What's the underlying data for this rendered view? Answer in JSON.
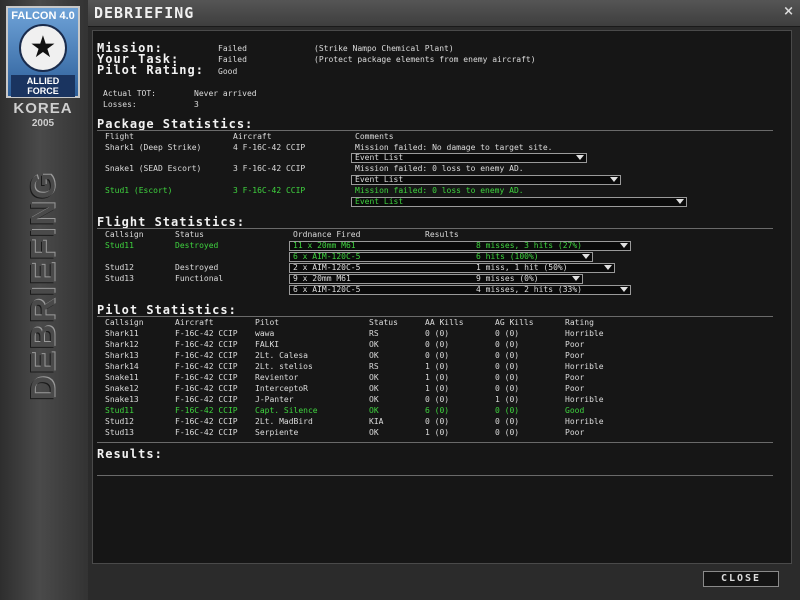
{
  "logo": {
    "top": "FALCON 4.0",
    "star": "★",
    "bottom": "ALLIED FORCE",
    "theater": "KOREA",
    "year": "2005"
  },
  "sidebar_title": "DEBRIEFING",
  "window": {
    "title": "DEBRIEFING",
    "close_glyph": "×"
  },
  "summary": {
    "mission_label": "Mission:",
    "mission_status": "Failed",
    "mission_desc": "(Strike Nampo Chemical Plant)",
    "task_label": "Your Task:",
    "task_status": "Failed",
    "task_desc": "(Protect package elements from enemy aircraft)",
    "rating_label": "Pilot Rating:",
    "rating_value": "Good",
    "tot_label": "Actual TOT:",
    "tot_value": "Never arrived",
    "losses_label": "Losses:",
    "losses_value": "3"
  },
  "package": {
    "title": "Package Statistics:",
    "headers": {
      "flight": "Flight",
      "aircraft": "Aircraft",
      "comments": "Comments"
    },
    "rows": [
      {
        "flight": "Shark1 (Deep Strike)",
        "aircraft": "4 F-16C-42 CCIP",
        "comment": "Mission failed: No damage to target site.",
        "dropdown": "Event List",
        "highlight": false
      },
      {
        "flight": "Snake1 (SEAD Escort)",
        "aircraft": "3 F-16C-42 CCIP",
        "comment": "Mission failed: 0 loss to enemy AD.",
        "dropdown": "Event List",
        "highlight": false
      },
      {
        "flight": "Stud1 (Escort)",
        "aircraft": "3 F-16C-42 CCIP",
        "comment": "Mission failed: 0 loss to enemy AD.",
        "dropdown": "Event List",
        "highlight": true
      }
    ]
  },
  "flight": {
    "title": "Flight Statistics:",
    "headers": {
      "callsign": "Callsign",
      "status": "Status",
      "ordnance": "Ordnance Fired",
      "results": "Results"
    },
    "rows": [
      {
        "callsign": "Stud11",
        "status": "Destroyed",
        "ordnance": "11 x 20mm M61",
        "result": "8 misses, 3 hits (27%)",
        "highlight": true
      },
      {
        "callsign": "",
        "status": "",
        "ordnance": "6 x AIM-120C-5",
        "result": "6 hits (100%)",
        "highlight": true
      },
      {
        "callsign": "Stud12",
        "status": "Destroyed",
        "ordnance": "2 x AIM-120C-5",
        "result": "1 miss, 1 hit (50%)",
        "highlight": false
      },
      {
        "callsign": "Stud13",
        "status": "Functional",
        "ordnance": "9 x 20mm M61",
        "result": "9 misses (0%)",
        "highlight": false
      },
      {
        "callsign": "",
        "status": "",
        "ordnance": "6 x AIM-120C-5",
        "result": "4 misses, 2 hits (33%)",
        "highlight": false
      }
    ]
  },
  "pilot": {
    "title": "Pilot Statistics:",
    "headers": {
      "callsign": "Callsign",
      "aircraft": "Aircraft",
      "pilot": "Pilot",
      "status": "Status",
      "aa": "AA Kills",
      "ag": "AG Kills",
      "rating": "Rating"
    },
    "rows": [
      {
        "callsign": "Shark11",
        "aircraft": "F-16C-42 CCIP",
        "pilot": "wawa",
        "status": "RS",
        "aa": "0 (0)",
        "ag": "0 (0)",
        "rating": "Horrible",
        "highlight": false
      },
      {
        "callsign": "Shark12",
        "aircraft": "F-16C-42 CCIP",
        "pilot": "FALKI",
        "status": "OK",
        "aa": "0 (0)",
        "ag": "0 (0)",
        "rating": "Poor",
        "highlight": false
      },
      {
        "callsign": "Shark13",
        "aircraft": "F-16C-42 CCIP",
        "pilot": "2Lt. Calesa",
        "status": "OK",
        "aa": "0 (0)",
        "ag": "0 (0)",
        "rating": "Poor",
        "highlight": false
      },
      {
        "callsign": "Shark14",
        "aircraft": "F-16C-42 CCIP",
        "pilot": "2Lt. stelios",
        "status": "RS",
        "aa": "1 (0)",
        "ag": "0 (0)",
        "rating": "Horrible",
        "highlight": false
      },
      {
        "callsign": "Snake11",
        "aircraft": "F-16C-42 CCIP",
        "pilot": "Revientor",
        "status": "OK",
        "aa": "1 (0)",
        "ag": "0 (0)",
        "rating": "Poor",
        "highlight": false
      },
      {
        "callsign": "Snake12",
        "aircraft": "F-16C-42 CCIP",
        "pilot": "InterceptoR",
        "status": "OK",
        "aa": "1 (0)",
        "ag": "0 (0)",
        "rating": "Poor",
        "highlight": false
      },
      {
        "callsign": "Snake13",
        "aircraft": "F-16C-42 CCIP",
        "pilot": "J-Panter",
        "status": "OK",
        "aa": "0 (0)",
        "ag": "1 (0)",
        "rating": "Horrible",
        "highlight": false
      },
      {
        "callsign": "Stud11",
        "aircraft": "F-16C-42 CCIP",
        "pilot": "Capt. Silence",
        "status": "OK",
        "aa": "6 (0)",
        "ag": "0 (0)",
        "rating": "Good",
        "highlight": true
      },
      {
        "callsign": "Stud12",
        "aircraft": "F-16C-42 CCIP",
        "pilot": "2Lt. MadBird",
        "status": "KIA",
        "aa": "0 (0)",
        "ag": "0 (0)",
        "rating": "Horrible",
        "highlight": false
      },
      {
        "callsign": "Stud13",
        "aircraft": "F-16C-42 CCIP",
        "pilot": "Serpiente",
        "status": "OK",
        "aa": "1 (0)",
        "ag": "0 (0)",
        "rating": "Poor",
        "highlight": false
      }
    ]
  },
  "results": {
    "title": "Results:"
  },
  "close_button": "CLOSE",
  "colors": {
    "highlight": "#3fd43f",
    "text": "#dcdcdc",
    "background": "#161616"
  }
}
